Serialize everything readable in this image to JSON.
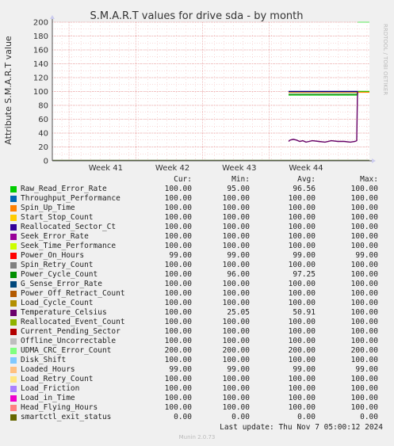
{
  "chart_data": {
    "type": "line",
    "title": "S.M.A.R.T values for drive sda - by month",
    "ylabel": "Attribute S.M.A.R.T value",
    "ylim": [
      0,
      200
    ],
    "yticks": [
      "0",
      "20",
      "40",
      "60",
      "80",
      "100",
      "120",
      "140",
      "160",
      "180",
      "200"
    ],
    "xticks": [
      "Week 41",
      "Week 42",
      "Week 43",
      "Week 44"
    ],
    "grid": true,
    "series_lines": [
      {
        "name": "Raw_Read_Error_Rate",
        "color": "#00cc00",
        "points": [
          [
            0.745,
            95
          ],
          [
            0.96,
            95
          ],
          [
            0.963,
            100
          ],
          [
            1.0,
            100
          ]
        ]
      },
      {
        "name": "Power_Cycle_Count",
        "color": "#339933",
        "points": [
          [
            0.745,
            96
          ],
          [
            0.96,
            96
          ]
        ]
      },
      {
        "name": "Power_On_Hours",
        "color": "#ff8800",
        "points": [
          [
            0.745,
            99
          ],
          [
            1.0,
            99
          ]
        ]
      },
      {
        "name": "Seek_Error_Rate",
        "color": "#000088",
        "points": [
          [
            0.745,
            100
          ],
          [
            0.963,
            100
          ]
        ]
      },
      {
        "name": "UDMA_CRC_Error_Count",
        "color": "#88ee88",
        "points": [
          [
            0.963,
            200
          ],
          [
            1.0,
            200
          ]
        ]
      },
      {
        "name": "smartctl_exit_status",
        "color": "#556b2f",
        "points": [
          [
            0.0,
            0.6
          ],
          [
            1.0,
            0.6
          ]
        ]
      },
      {
        "name": "Temperature_Celsius",
        "color": "#660066",
        "points": [
          [
            0.745,
            28
          ],
          [
            0.75,
            30
          ],
          [
            0.76,
            31
          ],
          [
            0.77,
            30
          ],
          [
            0.78,
            28
          ],
          [
            0.79,
            29
          ],
          [
            0.8,
            27
          ],
          [
            0.81,
            28
          ],
          [
            0.82,
            29
          ],
          [
            0.84,
            28
          ],
          [
            0.86,
            27
          ],
          [
            0.88,
            29
          ],
          [
            0.9,
            28
          ],
          [
            0.92,
            28
          ],
          [
            0.94,
            27
          ],
          [
            0.955,
            28
          ],
          [
            0.96,
            29
          ],
          [
            0.962,
            90
          ],
          [
            0.963,
            100
          ]
        ]
      }
    ]
  },
  "legend": {
    "headers": [
      "Cur:",
      "Min:",
      "Avg:",
      "Max:"
    ],
    "rows": [
      {
        "name": "Raw_Read_Error_Rate",
        "color": "#00cc00",
        "cur": "100.00",
        "min": "95.00",
        "avg": "96.56",
        "max": "100.00"
      },
      {
        "name": "Throughput_Performance",
        "color": "#0066b3",
        "cur": "100.00",
        "min": "100.00",
        "avg": "100.00",
        "max": "100.00"
      },
      {
        "name": "Spin_Up_Time",
        "color": "#ff8000",
        "cur": "100.00",
        "min": "100.00",
        "avg": "100.00",
        "max": "100.00"
      },
      {
        "name": "Start_Stop_Count",
        "color": "#ffcc00",
        "cur": "100.00",
        "min": "100.00",
        "avg": "100.00",
        "max": "100.00"
      },
      {
        "name": "Reallocated_Sector_Ct",
        "color": "#330099",
        "cur": "100.00",
        "min": "100.00",
        "avg": "100.00",
        "max": "100.00"
      },
      {
        "name": "Seek_Error_Rate",
        "color": "#990099",
        "cur": "100.00",
        "min": "100.00",
        "avg": "100.00",
        "max": "100.00"
      },
      {
        "name": "Seek_Time_Performance",
        "color": "#ccff00",
        "cur": "100.00",
        "min": "100.00",
        "avg": "100.00",
        "max": "100.00"
      },
      {
        "name": "Power_On_Hours",
        "color": "#ff0000",
        "cur": "99.00",
        "min": "99.00",
        "avg": "99.00",
        "max": "99.00"
      },
      {
        "name": "Spin_Retry_Count",
        "color": "#808080",
        "cur": "100.00",
        "min": "100.00",
        "avg": "100.00",
        "max": "100.00"
      },
      {
        "name": "Power_Cycle_Count",
        "color": "#008f00",
        "cur": "100.00",
        "min": "96.00",
        "avg": "97.25",
        "max": "100.00"
      },
      {
        "name": "G_Sense_Error_Rate",
        "color": "#00487d",
        "cur": "100.00",
        "min": "100.00",
        "avg": "100.00",
        "max": "100.00"
      },
      {
        "name": "Power_Off_Retract_Count",
        "color": "#b35a00",
        "cur": "100.00",
        "min": "100.00",
        "avg": "100.00",
        "max": "100.00"
      },
      {
        "name": "Load_Cycle_Count",
        "color": "#b38f00",
        "cur": "100.00",
        "min": "100.00",
        "avg": "100.00",
        "max": "100.00"
      },
      {
        "name": "Temperature_Celsius",
        "color": "#6b006b",
        "cur": "100.00",
        "min": "25.05",
        "avg": "50.91",
        "max": "100.00"
      },
      {
        "name": "Reallocated_Event_Count",
        "color": "#8fb300",
        "cur": "100.00",
        "min": "100.00",
        "avg": "100.00",
        "max": "100.00"
      },
      {
        "name": "Current_Pending_Sector",
        "color": "#b30000",
        "cur": "100.00",
        "min": "100.00",
        "avg": "100.00",
        "max": "100.00"
      },
      {
        "name": "Offline_Uncorrectable",
        "color": "#bebebe",
        "cur": "100.00",
        "min": "100.00",
        "avg": "100.00",
        "max": "100.00"
      },
      {
        "name": "UDMA_CRC_Error_Count",
        "color": "#80ff80",
        "cur": "200.00",
        "min": "200.00",
        "avg": "200.00",
        "max": "200.00"
      },
      {
        "name": "Disk_Shift",
        "color": "#80c9ff",
        "cur": "100.00",
        "min": "100.00",
        "avg": "100.00",
        "max": "100.00"
      },
      {
        "name": "Loaded_Hours",
        "color": "#ffc080",
        "cur": "99.00",
        "min": "99.00",
        "avg": "99.00",
        "max": "99.00"
      },
      {
        "name": "Load_Retry_Count",
        "color": "#ffe680",
        "cur": "100.00",
        "min": "100.00",
        "avg": "100.00",
        "max": "100.00"
      },
      {
        "name": "Load_Friction",
        "color": "#aa80ff",
        "cur": "100.00",
        "min": "100.00",
        "avg": "100.00",
        "max": "100.00"
      },
      {
        "name": "Load_in_Time",
        "color": "#ee00cc",
        "cur": "100.00",
        "min": "100.00",
        "avg": "100.00",
        "max": "100.00"
      },
      {
        "name": "Head_Flying_Hours",
        "color": "#ff8080",
        "cur": "100.00",
        "min": "100.00",
        "avg": "100.00",
        "max": "100.00"
      },
      {
        "name": "smartctl_exit_status",
        "color": "#666600",
        "cur": "0.00",
        "min": "0.00",
        "avg": "0.00",
        "max": "0.00"
      }
    ]
  },
  "footer": {
    "last_update": "Last update: Thu Nov  7 05:00:12 2024",
    "munin_version": "Munin 2.0.73",
    "side_label": "RRDTOOL / TOBI OETIKER"
  }
}
